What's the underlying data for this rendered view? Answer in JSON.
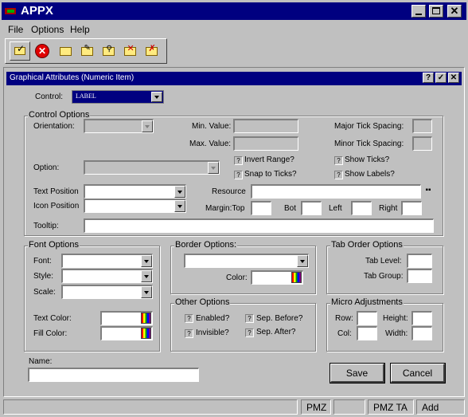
{
  "window": {
    "title": "APPX",
    "app_icon": "appx-logo-icon"
  },
  "menu": [
    "File",
    "Options",
    "Help"
  ],
  "toolbar": {
    "icons": [
      "check-folder-icon",
      "cancel-icon",
      "new-folder-icon",
      "edit-folder-icon",
      "search-folder-icon",
      "delete-folder-icon",
      "remove-folder-icon"
    ]
  },
  "dialog": {
    "title": "Graphical Attributes (Numeric Item)"
  },
  "control": {
    "label": "Control:",
    "value": "LABEL"
  },
  "control_options": {
    "title": "Control Options",
    "orientation": "Orientation:",
    "min_value": "Min. Value:",
    "max_value": "Max. Value:",
    "major_tick": "Major Tick Spacing:",
    "minor_tick": "Minor Tick Spacing:",
    "invert_range": "Invert Range?",
    "show_ticks": "Show Ticks?",
    "snap_to_ticks": "Snap to Ticks?",
    "show_labels": "Show Labels?",
    "option": "Option:",
    "text_position": "Text Position",
    "icon_position": "Icon Position",
    "resource": "Resource",
    "margin_top": "Margin:Top",
    "bot": "Bot",
    "left": "Left",
    "right": "Right",
    "tooltip": "Tooltip:"
  },
  "font_options": {
    "title": "Font Options",
    "font": "Font:",
    "style": "Style:",
    "scale": "Scale:",
    "text_color": "Text Color:",
    "fill_color": "Fill Color:"
  },
  "border_options": {
    "title": "Border Options:",
    "color": "Color:"
  },
  "tab_order": {
    "title": "Tab Order Options",
    "tab_level": "Tab Level:",
    "tab_group": "Tab Group:"
  },
  "other_options": {
    "title": "Other Options",
    "enabled": "Enabled?",
    "invisible": "Invisible?",
    "sep_before": "Sep. Before?",
    "sep_after": "Sep. After?"
  },
  "micro": {
    "title": "Micro Adjustments",
    "row": "Row:",
    "col": "Col:",
    "height": "Height:",
    "width": "Width:"
  },
  "name": {
    "label": "Name:",
    "value": ""
  },
  "buttons": {
    "save": "Save",
    "cancel": "Cancel"
  },
  "checkbox_glyph": "?",
  "status": [
    "",
    "PMZ",
    "",
    "PMZ TA",
    "Add"
  ]
}
